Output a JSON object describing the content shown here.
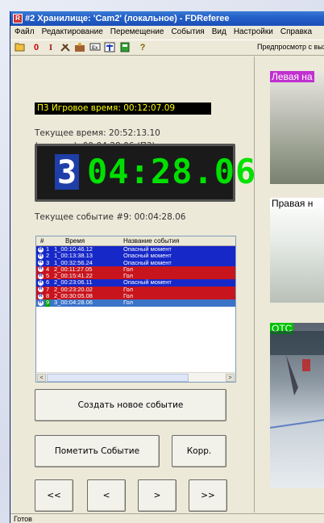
{
  "window": {
    "title": "#2 Хранилище: 'Cam2' (локальное) -  FDReferee"
  },
  "menu": [
    "Файл",
    "Редактирование",
    "Перемещение",
    "События",
    "Вид",
    "Настройки",
    "Справка"
  ],
  "toolbar": {
    "icons": [
      "folder-open-icon",
      "zero-icon",
      "cursor-i-icon",
      "tools-icon",
      "scene-icon",
      "monitor-icon",
      "target-icon",
      "film-icon",
      "help-icon"
    ],
    "preview_label": "Предпросмотр с вых"
  },
  "game_time_label": "П3 Игровое время: 00:12:07.09",
  "current_time_label": "Текущее время: 20:52:13.10",
  "game_offset_label": "(игровое): 00:04:28.06 (П3)",
  "clock": {
    "period": "3",
    "time": "04:28.06"
  },
  "current_event_label": "Текущее событие #9: 00:04:28.06",
  "event_list": {
    "headers": [
      "#",
      "Время",
      "Название события"
    ],
    "rows": [
      {
        "num": "1",
        "time": "1_00:10:46.12",
        "name": "Опасный момент",
        "color": "#1628c8"
      },
      {
        "num": "2",
        "time": "1_00:13:38.13",
        "name": "Опасный момент",
        "color": "#1628c8"
      },
      {
        "num": "3",
        "time": "1_00:32:56.24",
        "name": "Опасный момент",
        "color": "#1628c8"
      },
      {
        "num": "4",
        "time": "2_00:11:27.05",
        "name": "Гол",
        "color": "#c8141c"
      },
      {
        "num": "5",
        "time": "2_00:15:41.22",
        "name": "Гол",
        "color": "#c8141c"
      },
      {
        "num": "6",
        "time": "2_00:23:06.11",
        "name": "Опасный момент",
        "color": "#1628c8"
      },
      {
        "num": "7",
        "time": "2_00:23:20.02",
        "name": "Гол",
        "color": "#c8141c"
      },
      {
        "num": "8",
        "time": "2_00:30:05.08",
        "name": "Гол",
        "color": "#c8141c"
      },
      {
        "num": "9",
        "time": "3_00:04:28.06",
        "name": "Гол",
        "color": "#3a73c8"
      }
    ]
  },
  "buttons": {
    "create_event": "Создать новое событие",
    "mark_event": "Пометить Событие",
    "correct": "Корр.",
    "first": "<<",
    "prev": "<",
    "next": ">",
    "last": ">>"
  },
  "cameras": [
    {
      "label": "Левая на",
      "label_color": "#c030d0"
    },
    {
      "label": "Правая н",
      "label_color": "#000000"
    },
    {
      "label": "ОТС",
      "label_color": "#00c000"
    }
  ],
  "status": "Готов"
}
